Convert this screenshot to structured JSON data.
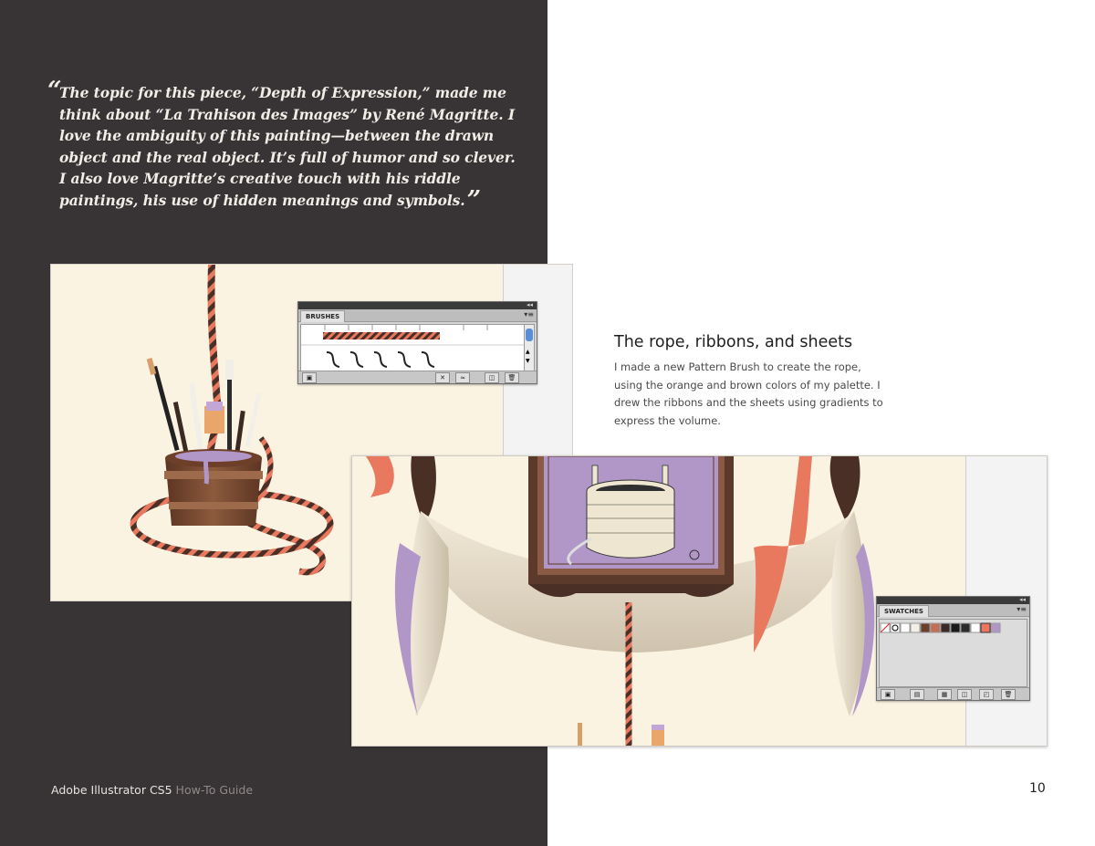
{
  "quote": {
    "open_mark": "“",
    "text": "The topic for this piece, “Depth of Expression,” made me think about “La Trahison des Images” by René Magritte. I love the ambiguity of this painting—between the drawn object and the real object. It’s full of humor and so clever. I also love Magritte’s creative touch with his riddle paintings, his use of hidden meanings and symbols.",
    "close_mark": "”"
  },
  "section": {
    "heading": "The rope, ribbons, and sheets",
    "body": "I made a new Pattern Brush to create the rope, using the orange and brown colors of my palette. I drew the ribbons and the sheets using gradients to express the volume."
  },
  "footer": {
    "product": "Adobe Illustrator CS5",
    "guide": "How-To Guide",
    "page_number": "10"
  },
  "brushes_panel": {
    "tab_label": "BRUSHES"
  },
  "swatches_panel": {
    "tab_label": "SWATCHES"
  },
  "colors": {
    "dark_bg": "#383435",
    "artboard": "#fbf3e1",
    "rope_orange": "#e8795f",
    "rope_brown": "#4a2f26",
    "lavender": "#b197c8",
    "wood": "#7a4a32"
  }
}
